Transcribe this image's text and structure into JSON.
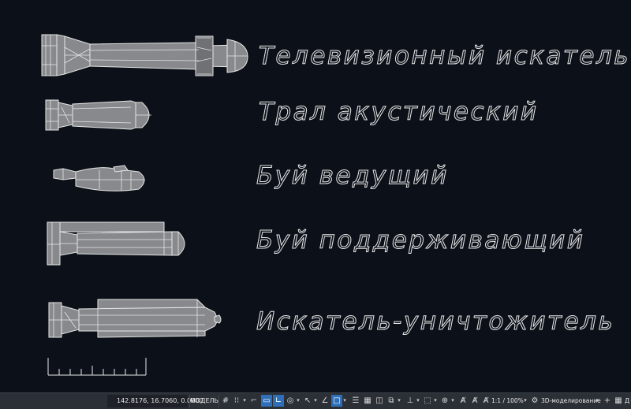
{
  "labels": {
    "tv_seeker": "Телевизионный искатель",
    "trawl": "Трал акустический",
    "buoy_leading": "Буй ведущий",
    "buoy_support": "Буй поддерживающий",
    "seeker_destroyer": "Искатель-уничтожитель"
  },
  "status": {
    "coords": "142.8176, 16.7060, 0.0000",
    "model": "МОДЕЛЬ",
    "scale": "1:1 / 100%",
    "workspace": "3D-моделирование",
    "cut_label": "Д"
  },
  "colors": {
    "background": "#0c1119",
    "statusbar": "#2b2f36",
    "active_button": "#2f6fb8",
    "line": "#e6e6e6",
    "fill": "#8a8c8f"
  }
}
